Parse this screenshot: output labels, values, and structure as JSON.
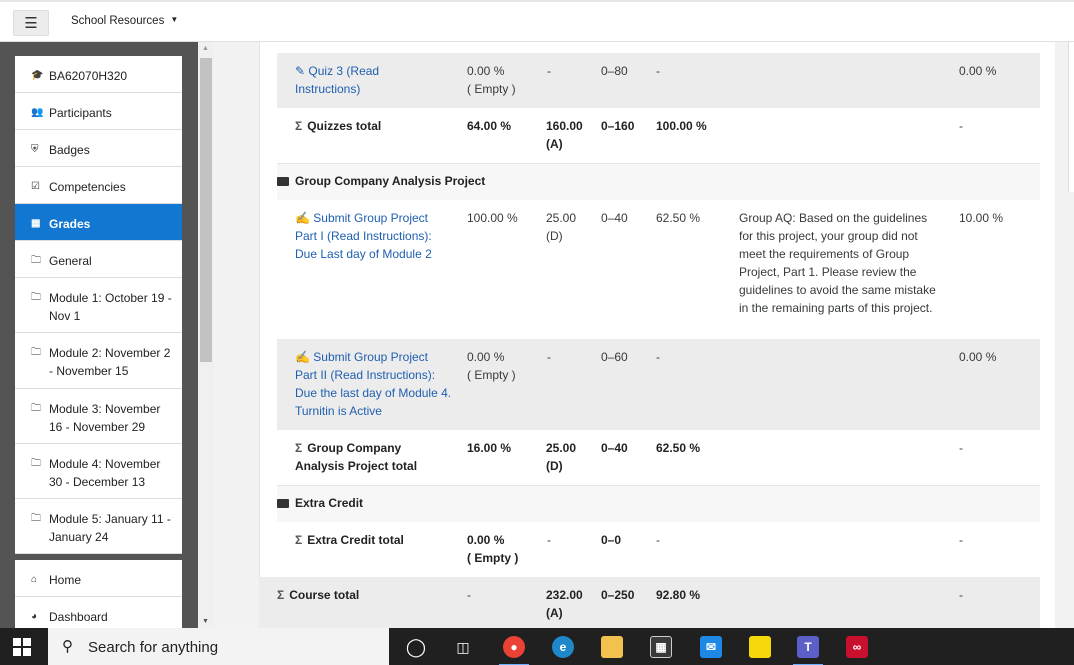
{
  "header": {
    "menu_icon": "hamburger-icon",
    "site_menu": "School Resources"
  },
  "sidebar": {
    "items": [
      {
        "label": "BA62070H320",
        "icon": "graduation-cap-icon"
      },
      {
        "label": "Participants",
        "icon": "users-icon"
      },
      {
        "label": "Badges",
        "icon": "shield-icon"
      },
      {
        "label": "Competencies",
        "icon": "checkbox-icon"
      },
      {
        "label": "Grades",
        "icon": "table-icon",
        "active": true
      },
      {
        "label": "General",
        "icon": "folder-icon"
      },
      {
        "label": "Module 1: October 19 - Nov 1",
        "icon": "folder-icon"
      },
      {
        "label": "Module 2: November 2 - November 15",
        "icon": "folder-icon"
      },
      {
        "label": "Module 3: November 16 - November 29",
        "icon": "folder-icon"
      },
      {
        "label": "Module 4: November 30 - December 13",
        "icon": "folder-icon"
      },
      {
        "label": "Module 5: January 11 - January 24",
        "icon": "folder-icon"
      }
    ],
    "bottom_items": [
      {
        "label": "Home",
        "icon": "home-icon"
      },
      {
        "label": "Dashboard",
        "icon": "dashboard-icon"
      }
    ]
  },
  "grades": {
    "quiz3": {
      "name_1": "Quiz 3 (Read",
      "name_2": "Instructions)",
      "weight_1": "0.00 %",
      "weight_2": "( Empty )",
      "grade": "-",
      "range": "0–80",
      "percent": "-",
      "contribution": "0.00 %"
    },
    "quizzes_total": {
      "name": "Quizzes total",
      "weight": "64.00 %",
      "grade_1": "160.00",
      "grade_2": "(A)",
      "range": "0–160",
      "percent": "100.00 %",
      "contribution": "-"
    },
    "cat_group": "Group Company Analysis Project",
    "gp1": {
      "name_1": "Submit Group Project",
      "name_2": "Part I (Read Instructions):",
      "name_3": "Due Last day of Module 2",
      "weight": "100.00 %",
      "grade_1": "25.00",
      "grade_2": "(D)",
      "range": "0–40",
      "percent": "62.50 %",
      "feedback": [
        "Group AQ: Based on the guidelines",
        "for this project, your group did not",
        "meet the requirements of Group",
        "Project, Part 1. Please review the",
        "guidelines to avoid the same mistake",
        "in the remaining parts of this project."
      ],
      "contribution": "10.00 %"
    },
    "gp2": {
      "name_1": "Submit Group Project",
      "name_2": "Part II (Read Instructions):",
      "name_3": "Due the last day of Module 4.",
      "name_4": "Turnitin is Active",
      "weight_1": "0.00 %",
      "weight_2": "( Empty )",
      "grade": "-",
      "range": "0–60",
      "percent": "-",
      "contribution": "0.00 %"
    },
    "group_total": {
      "name_1": "Group Company",
      "name_2": "Analysis Project total",
      "weight": "16.00 %",
      "grade_1": "25.00",
      "grade_2": "(D)",
      "range": "0–40",
      "percent": "62.50 %",
      "contribution": "-"
    },
    "cat_extra": "Extra Credit",
    "extra_total": {
      "name": "Extra Credit total",
      "weight_1": "0.00 %",
      "weight_2": "( Empty )",
      "grade": "-",
      "range": "0–0",
      "percent": "-",
      "contribution": "-"
    },
    "course_total": {
      "name": "Course total",
      "weight": "-",
      "grade_1": "232.00",
      "grade_2": "(A)",
      "range": "0–250",
      "percent": "92.80 %",
      "contribution": "-"
    }
  },
  "taskbar": {
    "search_placeholder": "Search for anything"
  },
  "colors": {
    "accent": "#1177d1",
    "link": "#1f5fb0"
  }
}
